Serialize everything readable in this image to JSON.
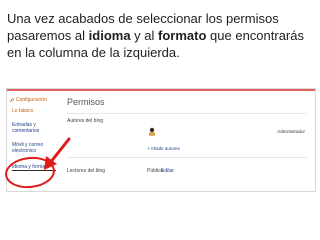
{
  "caption": {
    "part1": "Una vez acabados de seleccionar los permisos pasaremos al ",
    "bold1": "idioma",
    "part2": " y al ",
    "bold2": "formato",
    "part3": " que encontrarás en la columna de la izquierda."
  },
  "sidebar": {
    "header": "Configuración",
    "items": [
      {
        "label": "Lo básico",
        "active": true
      },
      {
        "label": "Entradas y comentarios"
      },
      {
        "label": "Móvil y correo electrónico"
      },
      {
        "label": "Idioma y formato"
      }
    ]
  },
  "main": {
    "title": "Permisos",
    "authors_label": "Autores del blog",
    "admin_label": "Administrador",
    "add_authors_label": "+ Añadir autores",
    "readers_label": "Lectores del blog",
    "public_label": "Público",
    "edit_label": "Editar"
  },
  "colors": {
    "accent_red": "#e11a1a",
    "link_blue": "#224488",
    "header_orange": "#c06010"
  }
}
